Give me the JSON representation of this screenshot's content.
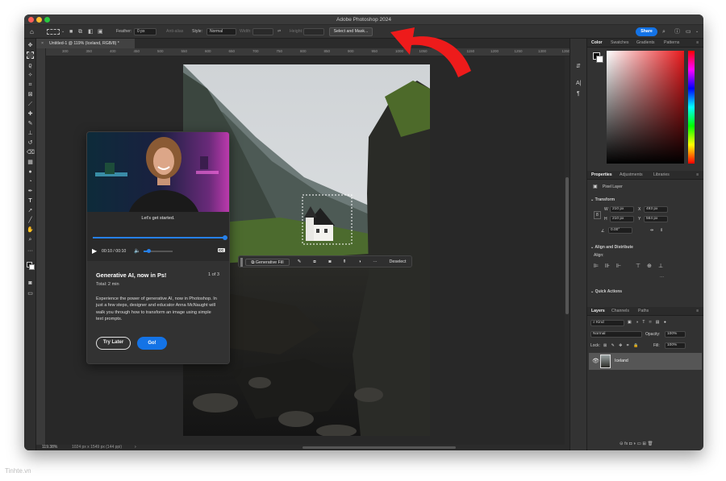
{
  "window": {
    "title": "Adobe Photoshop 2024"
  },
  "options_bar": {
    "feather_label": "Feather:",
    "feather_value": "0 px",
    "antialias_label": "Anti-alias",
    "style_label": "Style:",
    "style_value": "Normal",
    "width_label": "Width:",
    "height_label": "Height:",
    "select_mask_label": "Select and Mask...",
    "share_label": "Share"
  },
  "document": {
    "tab_title": "Untitled-1 @ 119% (Iceland, RGB/8) *",
    "ruler_ticks": [
      "300",
      "350",
      "400",
      "450",
      "500",
      "550",
      "600",
      "650",
      "700",
      "750",
      "800",
      "850",
      "900",
      "950",
      "1000",
      "1050",
      "1100",
      "1150",
      "1200",
      "1250",
      "1300",
      "1350",
      "1400",
      "1450",
      "1500"
    ],
    "zoom": "119.38%",
    "doc_info": "1024 px x 1549 px (144 ppi)"
  },
  "contextual_taskbar": {
    "generative_fill_label": "Generative Fill",
    "more_label": "···",
    "deselect_label": "Deselect"
  },
  "onboarding": {
    "video_caption": "Let's get started.",
    "time": "00:10 / 00:10",
    "cc_label": "CC",
    "progress": 1.0,
    "title": "Generative AI, now in Ps!",
    "step": "1 of 3",
    "total": "Total: 2 min",
    "description": "Experience the power of generative AI, now in Photoshop. In just a few steps, designer and educator Anna McNaught will walk you through how to transform an image using simple text prompts.",
    "try_later_label": "Try Later",
    "go_label": "Go!"
  },
  "panels": {
    "color_tabs": [
      "Color",
      "Swatches",
      "Gradients",
      "Patterns"
    ],
    "properties_tabs": [
      "Properties",
      "Adjustments",
      "Libraries"
    ],
    "pixel_layer_label": "Pixel Layer",
    "transform_title": "Transform",
    "w_label": "W",
    "w_value": "210 px",
    "x_label": "X",
    "x_value": "493 px",
    "h_label": "H",
    "h_value": "210 px",
    "y_label": "Y",
    "y_value": "564 px",
    "angle_value": "0.00°",
    "align_title": "Align and Distribute",
    "align_label": "Align:",
    "quick_actions_title": "Quick Actions",
    "layers_tabs": [
      "Layers",
      "Channels",
      "Paths"
    ],
    "kind_label": "Kind",
    "blend_mode": "Normal",
    "opacity_label": "Opacity:",
    "opacity_value": "100%",
    "lock_label": "Lock:",
    "fill_label": "Fill:",
    "fill_value": "100%",
    "layer_name": "Iceland",
    "footer_icons": "⊝  fx  ◘  ◑  ▭  ⊞  🗑"
  },
  "watermark": "Tinhte.vn",
  "colors": {
    "accent": "#1473e6",
    "annotation_arrow": "#ee1b1b",
    "foreground": "#000000",
    "background": "#ffffff"
  }
}
